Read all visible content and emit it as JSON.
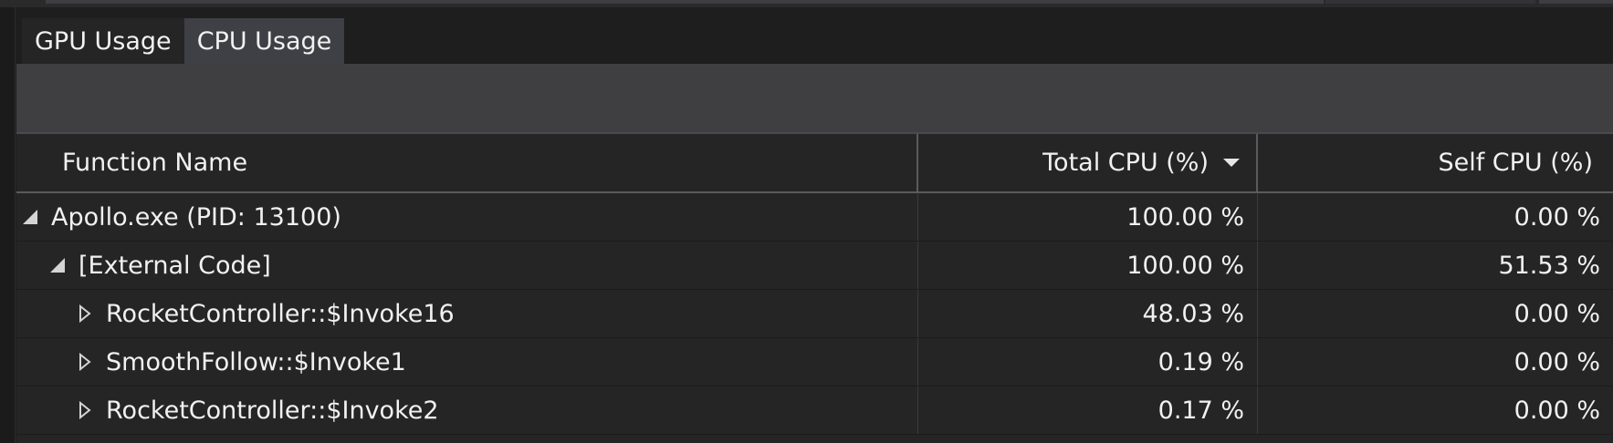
{
  "tabs": [
    {
      "label": "GPU Usage",
      "active": false
    },
    {
      "label": "CPU Usage",
      "active": true
    }
  ],
  "table": {
    "columns": {
      "function_name": "Function Name",
      "total_cpu": "Total CPU (%)",
      "self_cpu": "Self CPU (%)"
    },
    "sort": {
      "column": "total_cpu",
      "direction": "descending"
    },
    "rows": [
      {
        "name": "Apollo.exe (PID: 13100)",
        "total": "100.00 %",
        "self": "0.00 %",
        "level": 0,
        "state": "expanded"
      },
      {
        "name": "[External Code]",
        "total": "100.00 %",
        "self": "51.53 %",
        "level": 1,
        "state": "expanded"
      },
      {
        "name": "RocketController::$Invoke16",
        "total": "48.03 %",
        "self": "0.00 %",
        "level": 2,
        "state": "collapsed"
      },
      {
        "name": "SmoothFollow::$Invoke1",
        "total": "0.19 %",
        "self": "0.00 %",
        "level": 2,
        "state": "collapsed"
      },
      {
        "name": "RocketController::$Invoke2",
        "total": "0.17 %",
        "self": "0.00 %",
        "level": 2,
        "state": "collapsed"
      }
    ]
  },
  "colors": {
    "background": "#1e1e1e",
    "active_tab": "#3f3f46",
    "toolbar": "#3f3f42",
    "grid_row": "#252526",
    "text": "#f1f1f1"
  },
  "icons": {
    "expanded": "expanded-triangle-icon",
    "collapsed": "collapsed-triangle-icon",
    "sort": "sort-descending-icon"
  }
}
